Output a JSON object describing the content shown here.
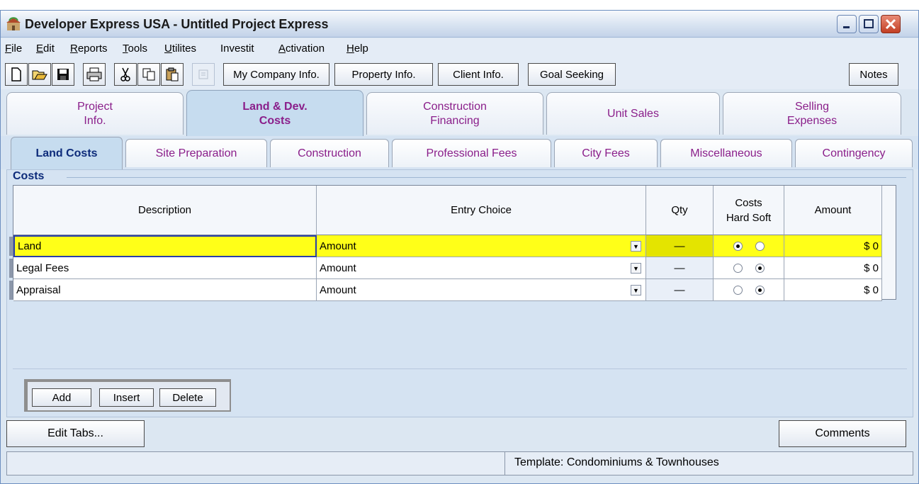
{
  "window": {
    "title": "Developer Express  USA - Untitled Project Express"
  },
  "menu": [
    {
      "label": "File",
      "mnemonic": "F",
      "rest": "ile"
    },
    {
      "label": "Edit",
      "mnemonic": "E",
      "rest": "dit"
    },
    {
      "label": "Reports",
      "mnemonic": "R",
      "rest": "eports"
    },
    {
      "label": "Tools",
      "mnemonic": "T",
      "rest": "ools"
    },
    {
      "label": "Utilites",
      "mnemonic": "U",
      "rest": "tilites"
    },
    {
      "label": "Investit",
      "mnemonic": "",
      "rest": "Investit"
    },
    {
      "label": "Activation",
      "mnemonic": "A",
      "rest": "ctivation"
    },
    {
      "label": "Help",
      "mnemonic": "H",
      "rest": "elp"
    }
  ],
  "toolbar": {
    "icons": [
      "new-icon",
      "open-icon",
      "save-icon",
      "print-icon",
      "cut-icon",
      "copy-icon",
      "paste-icon",
      "disabled-doc-icon"
    ],
    "buttons": [
      "My Company Info.",
      "Property Info.",
      "Client Info.",
      "Goal Seeking",
      "Notes"
    ]
  },
  "main_tabs": [
    {
      "line1": "Project",
      "line2": "Info."
    },
    {
      "line1": "Land & Dev.",
      "line2": "Costs",
      "active": true
    },
    {
      "line1": "Construction",
      "line2": "Financing"
    },
    {
      "line1": "Unit Sales",
      "line2": ""
    },
    {
      "line1": "Selling",
      "line2": "Expenses"
    }
  ],
  "sub_tabs": [
    "Land Costs",
    "Site Preparation",
    "Construction",
    "Professional Fees",
    "City Fees",
    "Miscellaneous",
    "Contingency"
  ],
  "active_sub_tab": "Land Costs",
  "costs": {
    "group_title": "Costs",
    "columns": {
      "description": "Description",
      "entry_choice": "Entry Choice",
      "qty": "Qty",
      "costs_line1": "Costs",
      "costs_line2": "Hard Soft",
      "amount": "Amount"
    },
    "rows": [
      {
        "description": "Land",
        "entry_choice": "Amount",
        "qty": "—",
        "cost_type": "Hard",
        "amount": "$ 0",
        "selected": true
      },
      {
        "description": "Legal Fees",
        "entry_choice": "Amount",
        "qty": "—",
        "cost_type": "Soft",
        "amount": "$ 0"
      },
      {
        "description": "Appraisal",
        "entry_choice": "Amount",
        "qty": "—",
        "cost_type": "Soft",
        "amount": "$ 0"
      }
    ]
  },
  "row_buttons": {
    "add": "Add",
    "insert": "Insert",
    "delete": "Delete"
  },
  "footer_buttons": {
    "edit_tabs": "Edit Tabs...",
    "comments": "Comments"
  },
  "status": {
    "template": "Template: Condominiums & Townhouses"
  },
  "colors": {
    "tab_text": "#8a1e8a",
    "active_subtab_text": "#0d2b7a",
    "selected_row": "#ffff18",
    "active_tab_bg": "#c6dcef"
  }
}
